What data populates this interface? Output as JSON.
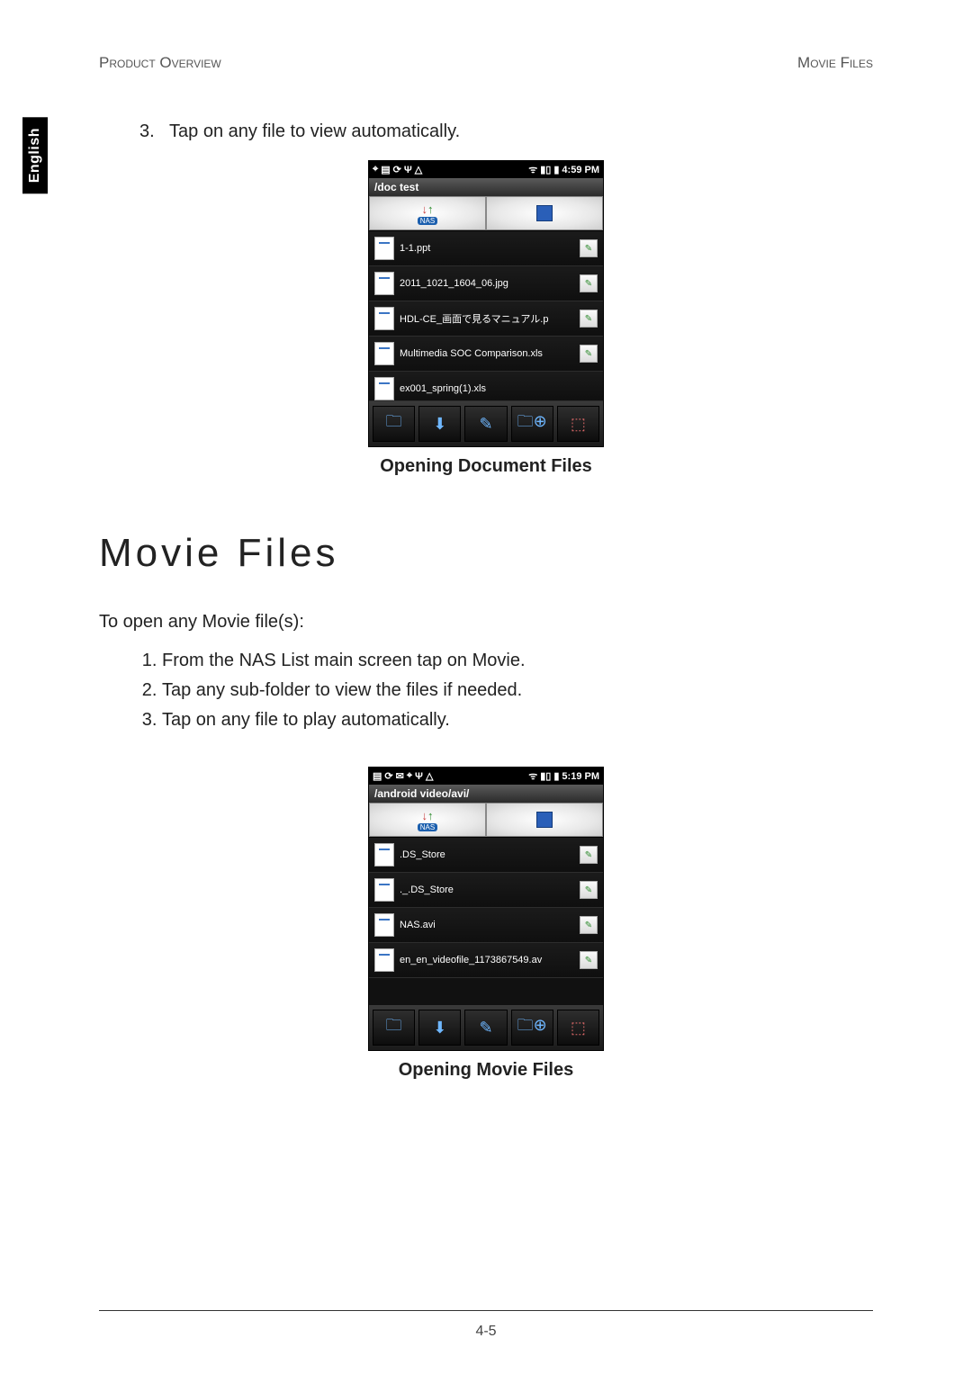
{
  "header": {
    "left": "Product Overview",
    "right": "Movie Files"
  },
  "language_tab": "English",
  "top_step": {
    "number": "3.",
    "text": "Tap on any file to view automatically."
  },
  "phone1": {
    "time": "4:59 PM",
    "path": "/doc test",
    "nas_label": "NAS",
    "files": [
      "1-1.ppt",
      "2011_1021_1604_06.jpg",
      "HDL-CE_画面で見るマニュアル.p",
      "Multimedia SOC Comparison.xls",
      "ex001_spring(1).xls"
    ],
    "toolbar_icons": [
      "folder-icon",
      "download-icon",
      "edit-icon",
      "folder-add-icon",
      "select-icon"
    ]
  },
  "caption1": "Opening Document Files",
  "section_title": "Movie Files",
  "intro": "To open any Movie file(s):",
  "steps": [
    "From the NAS List main screen tap on Movie.",
    "Tap any sub-folder to view the files if needed.",
    "Tap on any file to play automatically."
  ],
  "phone2": {
    "time": "5:19 PM",
    "path": "/android video/avi/",
    "nas_label": "NAS",
    "files": [
      ".DS_Store",
      "._.DS_Store",
      "NAS.avi",
      "en_en_videofile_1173867549.av"
    ],
    "toolbar_icons": [
      "folder-icon",
      "download-icon",
      "edit-icon",
      "folder-add-icon",
      "select-icon"
    ]
  },
  "caption2": "Opening Movie Files",
  "page_number": "4-5"
}
